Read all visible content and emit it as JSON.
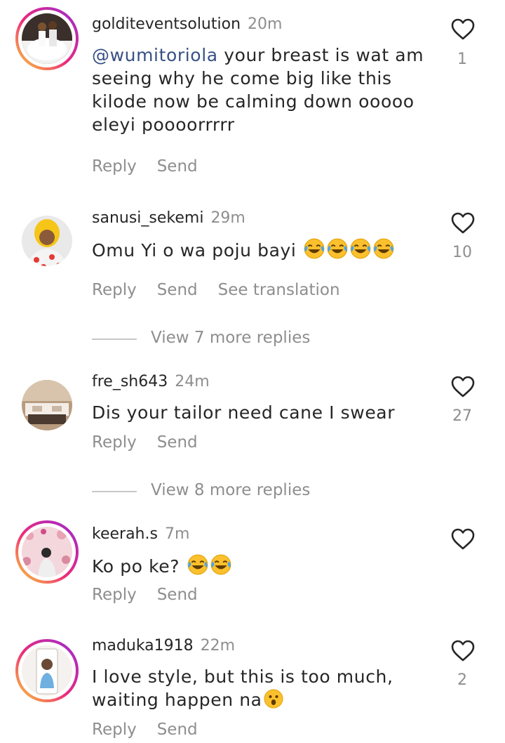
{
  "comments": [
    {
      "username": "golditeventsolution",
      "time": "20m",
      "mention": "@wumitoriola",
      "text": " your breast is wat am seeing why he come big like  this kilode now be calming down ooooo eleyi poooorrrrr",
      "likes": "1",
      "reply_label": "Reply",
      "send_label": "Send"
    },
    {
      "username": "sanusi_sekemi",
      "time": "29m",
      "text": "Omu Yi o wa poju bayi",
      "emojis": [
        "face-with-tears-of-joy",
        "face-with-tears-of-joy",
        "face-with-tears-of-joy",
        "face-with-tears-of-joy"
      ],
      "likes": "10",
      "reply_label": "Reply",
      "send_label": "Send",
      "translation_label": "See translation",
      "view_replies": "View 7 more replies"
    },
    {
      "username": "fre_sh643",
      "time": "24m",
      "text": "Dis your tailor need cane I swear",
      "likes": "27",
      "reply_label": "Reply",
      "send_label": "Send",
      "view_replies": "View 8 more replies"
    },
    {
      "username": "keerah.s",
      "time": "7m",
      "text": "Ko po ke?",
      "emojis": [
        "face-with-tears-of-joy",
        "face-with-tears-of-joy"
      ],
      "likes": "",
      "reply_label": "Reply",
      "send_label": "Send"
    },
    {
      "username": "maduka1918",
      "time": "22m",
      "text": "I love style, but this is too much, waiting happen na",
      "emojis": [
        "astonished-face"
      ],
      "likes": "2",
      "reply_label": "Reply",
      "send_label": "Send"
    }
  ],
  "colors": {
    "text": "#262626",
    "secondary": "#8e8e8e",
    "mention": "#385185",
    "story_ring": [
      "#f09433",
      "#dc2743",
      "#bc1888"
    ]
  }
}
